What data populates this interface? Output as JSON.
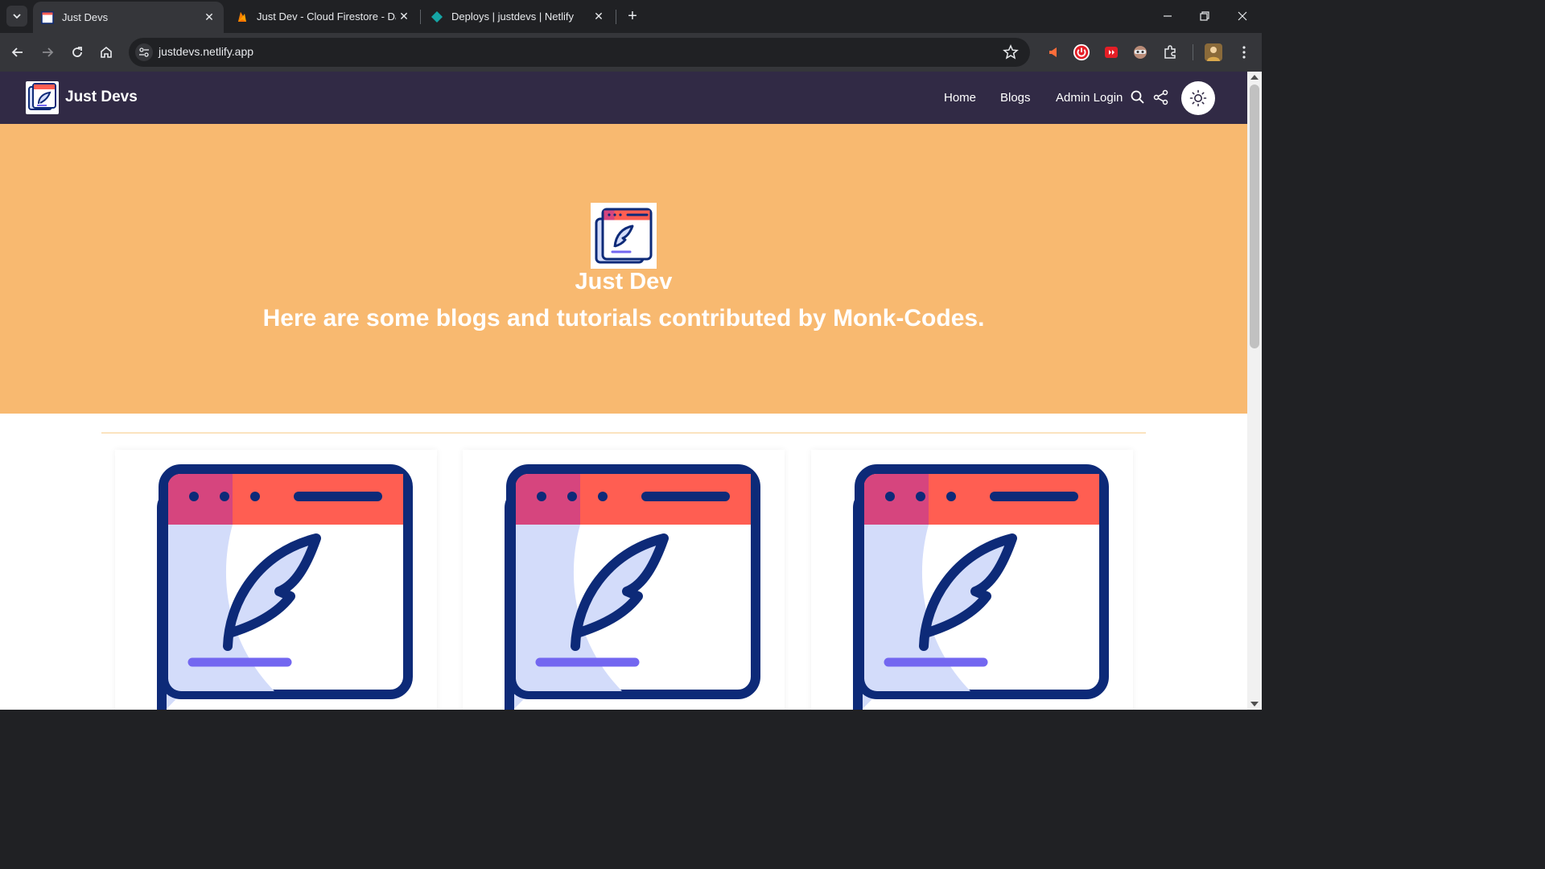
{
  "browser": {
    "tabs": [
      {
        "title": "Just Devs",
        "favicon": "just-devs-favicon",
        "active": true
      },
      {
        "title": "Just Dev - Cloud Firestore - Dat",
        "favicon": "firebase-favicon",
        "active": false
      },
      {
        "title": "Deploys | justdevs | Netlify",
        "favicon": "netlify-favicon",
        "active": false
      }
    ],
    "new_tab_label": "+",
    "url": "justdevs.netlify.app"
  },
  "site": {
    "brand": "Just Devs",
    "nav": {
      "home": "Home",
      "blogs": "Blogs",
      "admin_login": "Admin Login"
    },
    "hero": {
      "title": "Just Dev",
      "subtitle": "Here are some blogs and tutorials contributed by Monk-Codes."
    },
    "colors": {
      "navbar": "#312a45",
      "hero": "#f8b970",
      "icon_navy": "#0d2a78",
      "icon_red": "#ff5e52",
      "icon_pink": "#d6457e",
      "icon_lavender": "#d3dcfa",
      "icon_violet": "#7367f0"
    },
    "cards": [
      {
        "image": "blog-quill-window-icon"
      },
      {
        "image": "blog-quill-window-icon"
      },
      {
        "image": "blog-quill-window-icon"
      }
    ]
  }
}
